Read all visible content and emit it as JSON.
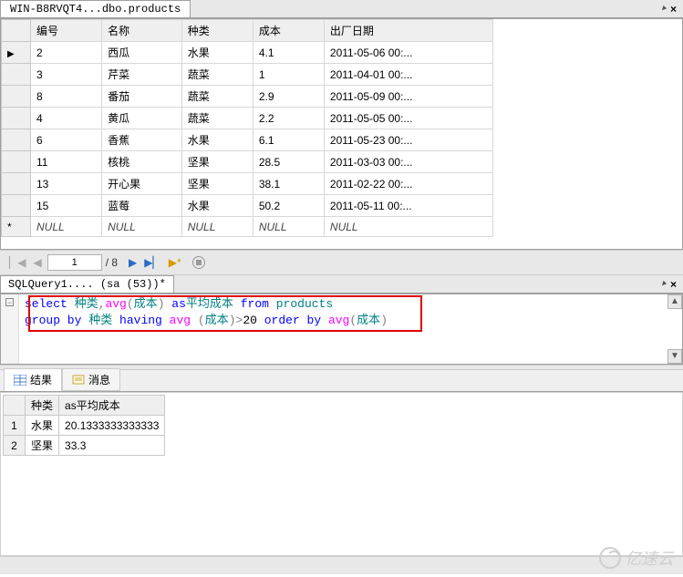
{
  "top_tab": {
    "title": "WIN-B8RVQT4...dbo.products"
  },
  "grid": {
    "columns": [
      "编号",
      "名称",
      "种类",
      "成本",
      "出厂日期"
    ],
    "rows": [
      {
        "c0": "2",
        "c1": "西瓜",
        "c2": "水果",
        "c3": "4.1",
        "c4": "2011-05-06 00:..."
      },
      {
        "c0": "3",
        "c1": "芹菜",
        "c2": "蔬菜",
        "c3": "1",
        "c4": "2011-04-01 00:..."
      },
      {
        "c0": "8",
        "c1": "番茄",
        "c2": "蔬菜",
        "c3": "2.9",
        "c4": "2011-05-09 00:..."
      },
      {
        "c0": "4",
        "c1": "黄瓜",
        "c2": "蔬菜",
        "c3": "2.2",
        "c4": "2011-05-05 00:..."
      },
      {
        "c0": "6",
        "c1": "香蕉",
        "c2": "水果",
        "c3": "6.1",
        "c4": "2011-05-23 00:..."
      },
      {
        "c0": "11",
        "c1": "核桃",
        "c2": "坚果",
        "c3": "28.5",
        "c4": "2011-03-03 00:..."
      },
      {
        "c0": "13",
        "c1": "开心果",
        "c2": "坚果",
        "c3": "38.1",
        "c4": "2011-02-22 00:..."
      },
      {
        "c0": "15",
        "c1": "蓝莓",
        "c2": "水果",
        "c3": "50.2",
        "c4": "2011-05-11 00:..."
      }
    ],
    "null_row": {
      "val": "NULL"
    }
  },
  "nav": {
    "current": "1",
    "total": "/ 8"
  },
  "query_tab": {
    "title": "SQLQuery1.... (sa (53))*"
  },
  "sql": {
    "select": "select",
    "col1": "种类",
    "comma": ",",
    "avg": "avg",
    "lp": "(",
    "cost": "成本",
    "rp": ")",
    "as": " as",
    "alias": "平均成本",
    "from": " from",
    "table": " products",
    "groupby": "group by",
    "gcol": " 种类",
    "having": " having",
    "havg": " avg",
    "hlp": " (",
    "hcost": "成本",
    "hrp": ")",
    "gt": ">",
    "twenty": "20",
    "orderby": " order by",
    "oavg": " avg",
    "olp": "(",
    "ocost": "成本",
    "orp": ")"
  },
  "result_tabs": {
    "results": "结果",
    "messages": "消息"
  },
  "result": {
    "columns": [
      "种类",
      "as平均成本"
    ],
    "rows": [
      {
        "n": "1",
        "c0": "水果",
        "c1": "20.1333333333333"
      },
      {
        "n": "2",
        "c0": "坚果",
        "c1": "33.3"
      }
    ]
  },
  "watermark": "亿速云"
}
